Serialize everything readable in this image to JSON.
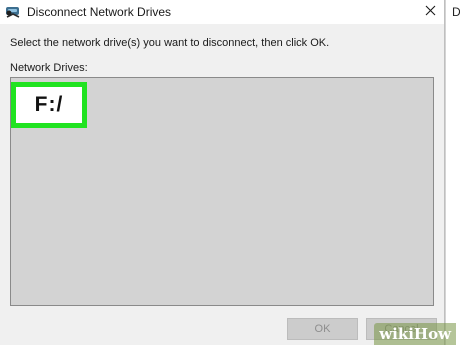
{
  "window": {
    "title": "Disconnect Network Drives",
    "icon": "network-drive-icon",
    "close_icon": "close-icon"
  },
  "background_window": {
    "letter": "D"
  },
  "dialog": {
    "instruction": "Select the network drive(s) you want to disconnect, then click OK.",
    "list_label": "Network Drives:",
    "drives": [
      {
        "label": "F:/",
        "highlighted": true
      }
    ],
    "buttons": {
      "ok": "OK",
      "cancel": "Cancel"
    }
  },
  "colors": {
    "highlight": "#20e320",
    "list_background": "#d3d3d3",
    "dialog_background": "#f0f0f0"
  },
  "watermark": "wikiHow"
}
